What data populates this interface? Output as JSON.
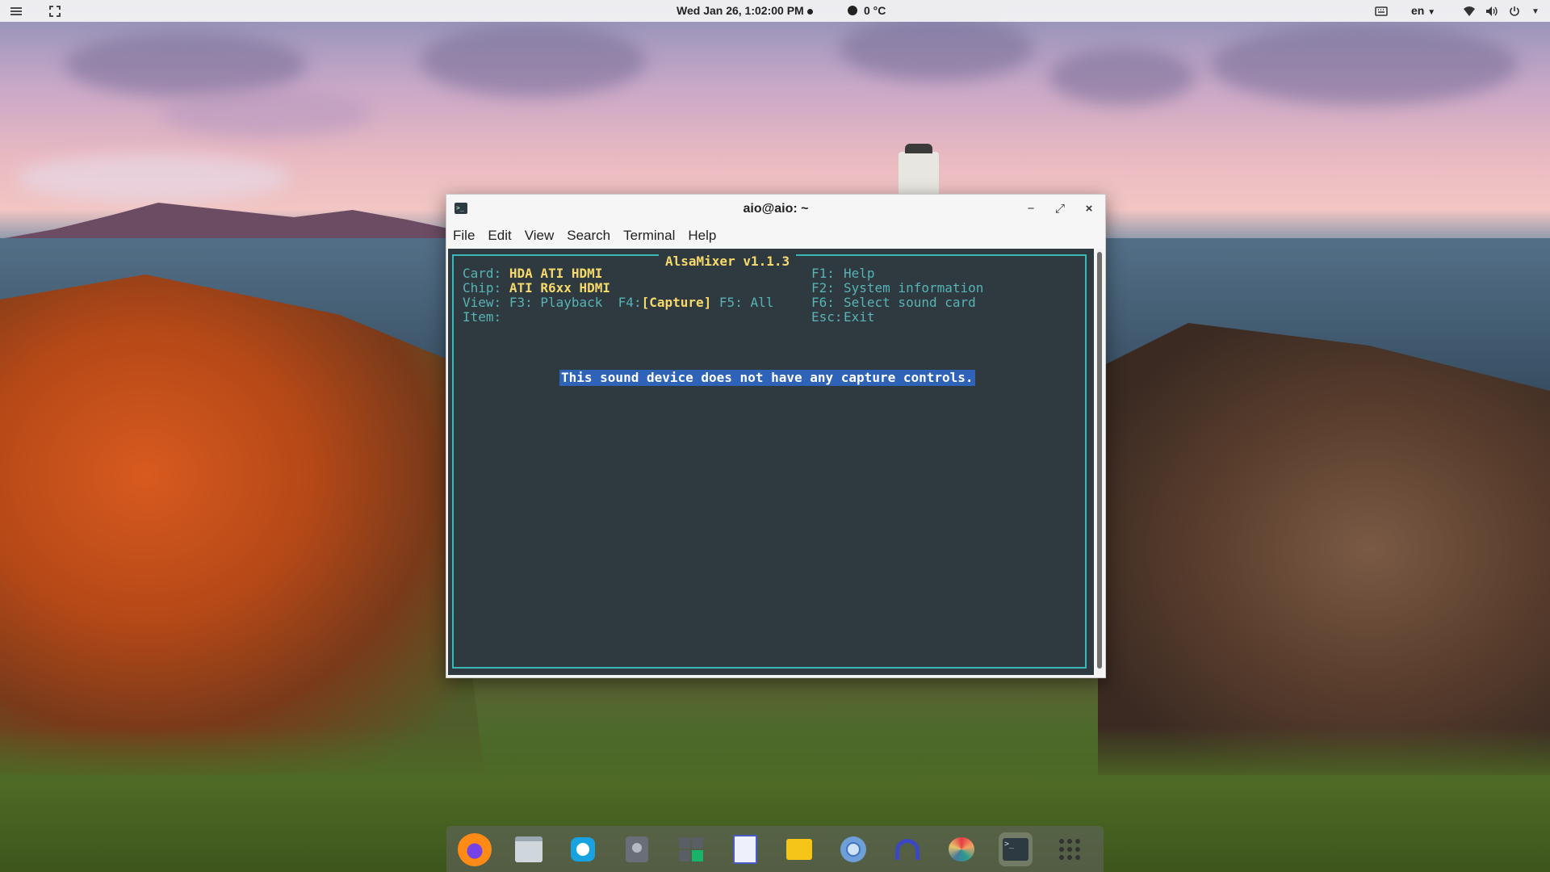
{
  "topbar": {
    "clock": "Wed Jan 26, 1:02:00 PM",
    "weather": "0 °C",
    "language": "en",
    "icons": [
      "activities-icon",
      "screenshot-icon",
      "keyboard-icon",
      "wifi-icon",
      "volume-icon",
      "power-icon"
    ]
  },
  "window": {
    "title": "aio@aio: ~",
    "buttons": {
      "minimize": "−",
      "maximize": "⤢",
      "close": "×"
    },
    "menu": [
      "File",
      "Edit",
      "View",
      "Search",
      "Terminal",
      "Help"
    ]
  },
  "alsamixer": {
    "title": "AlsaMixer v1.1.3",
    "card_label": "Card:",
    "card_value": "HDA ATI HDMI",
    "chip_label": "Chip:",
    "chip_value": "ATI R6xx HDMI",
    "view_label": "View:",
    "view_f3": "F3: Playback",
    "view_f4_key": "F4:",
    "view_f4_value": "[Capture]",
    "view_f5": "F5: All",
    "item_label": "Item:",
    "keys": [
      {
        "key": "F1:",
        "action": "Help"
      },
      {
        "key": "F2:",
        "action": "System information"
      },
      {
        "key": "F6:",
        "action": "Select sound card"
      },
      {
        "key": "Esc:",
        "action": "Exit"
      }
    ],
    "message": "This sound device does not have any capture controls."
  },
  "dock": {
    "apps": [
      "firefox-icon",
      "files-icon",
      "messaging-icon",
      "disk-utility-icon",
      "calculator-icon",
      "text-editor-icon",
      "archive-manager-icon",
      "chromium-icon",
      "audio-player-icon",
      "color-picker-icon",
      "terminal-icon",
      "app-grid-icon"
    ]
  },
  "colors": {
    "terminal_bg": "#2e3a40",
    "terminal_fg": "#58b3b5",
    "highlight": "#f7d96b",
    "selection": "#2f63b8"
  }
}
